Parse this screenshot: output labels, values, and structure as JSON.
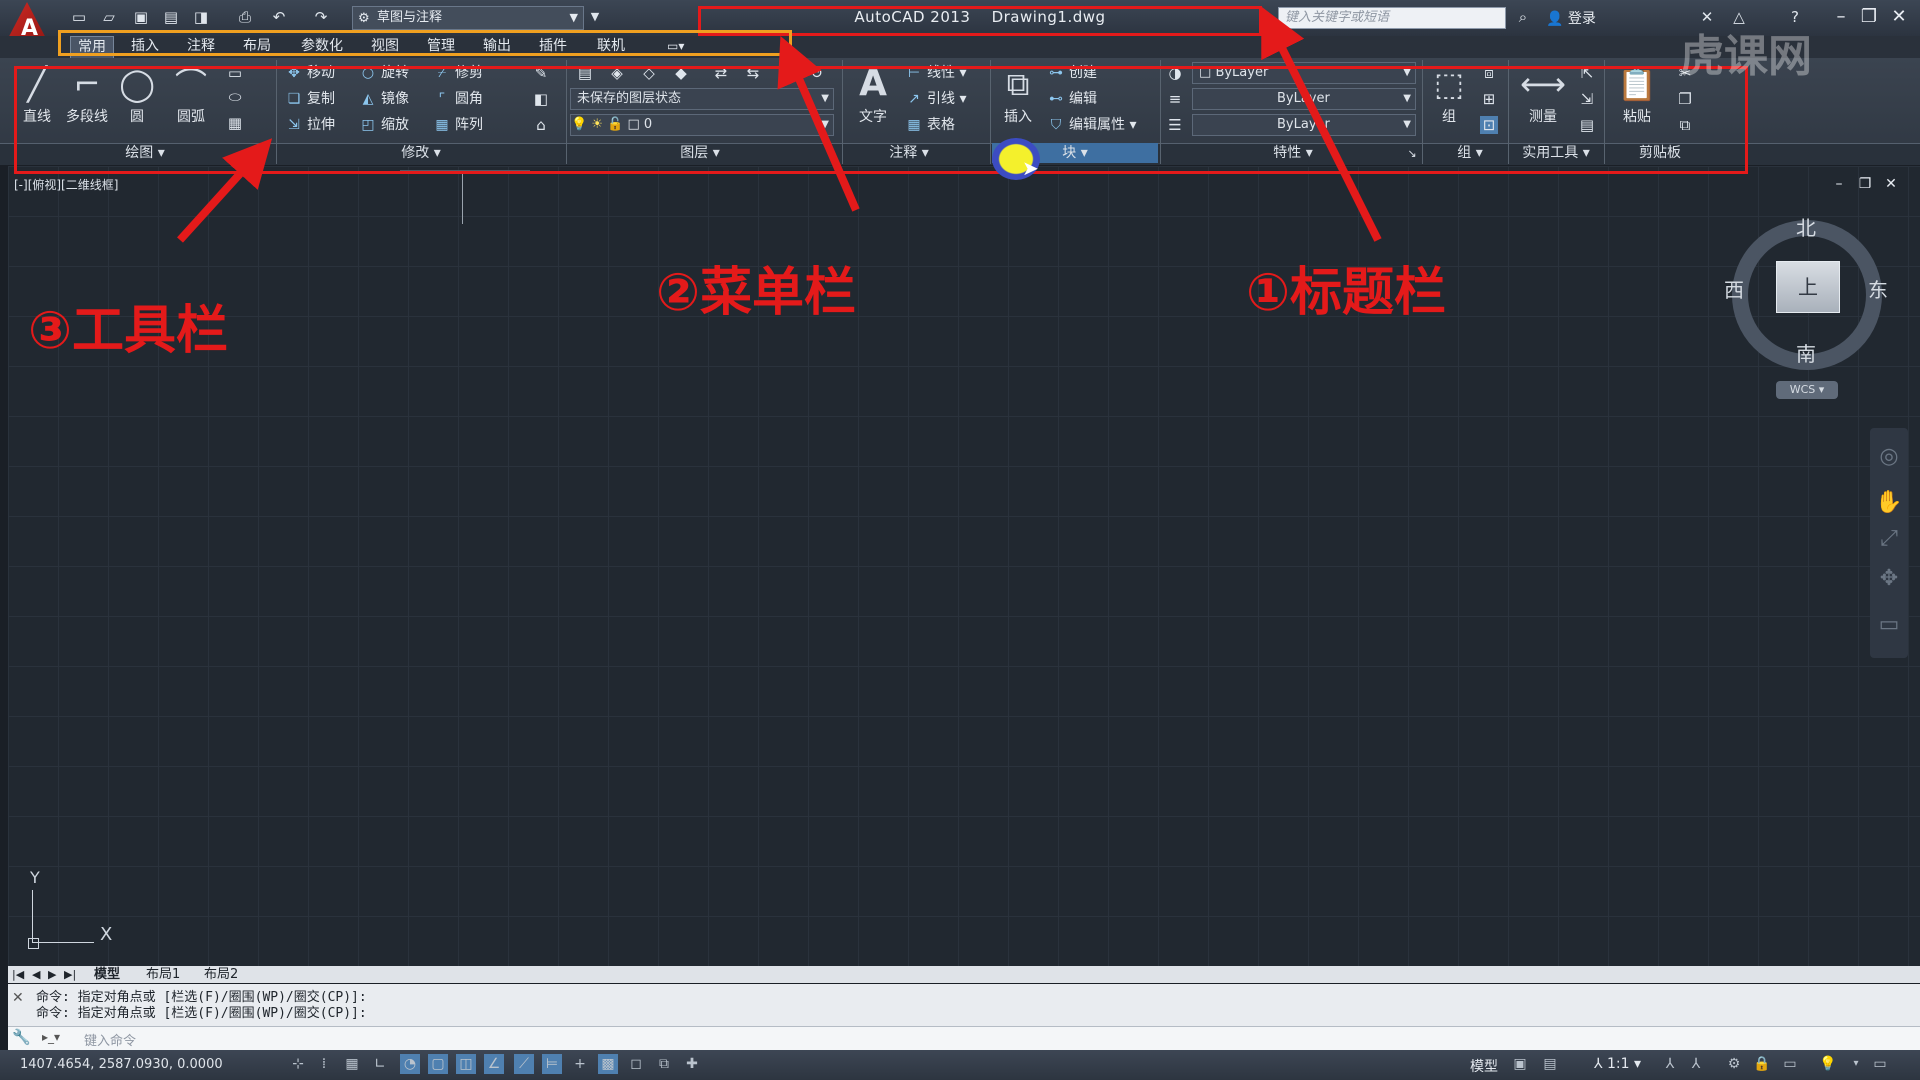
{
  "title_bar": {
    "app_name": "AutoCAD 2013",
    "document": "Drawing1.dwg",
    "workspace": "草图与注释",
    "search_placeholder": "键入关键字或短语",
    "login": "登录",
    "logo_letter": "A"
  },
  "ribbon_tabs": [
    "常用",
    "插入",
    "注释",
    "布局",
    "参数化",
    "视图",
    "管理",
    "输出",
    "插件",
    "联机"
  ],
  "draw_panel": {
    "title": "绘图",
    "tools": [
      "直线",
      "多段线",
      "圆",
      "圆弧"
    ]
  },
  "modify_panel": {
    "title": "修改",
    "row1": [
      "移动",
      "旋转",
      "修剪"
    ],
    "row2": [
      "复制",
      "镜像",
      "圆角"
    ],
    "row3": [
      "拉伸",
      "缩放",
      "阵列"
    ]
  },
  "layers_panel": {
    "title": "图层",
    "layer_state": "未保存的图层状态",
    "current_layer": "0"
  },
  "annotation_panel": {
    "title": "注释",
    "text_tool": "文字",
    "tools": [
      "线性",
      "引线",
      "表格"
    ]
  },
  "block_panel": {
    "title": "块",
    "insert": "插入",
    "tools": [
      "创建",
      "编辑",
      "编辑属性"
    ]
  },
  "properties_panel": {
    "title": "特性",
    "color": "ByLayer",
    "linetype": "ByLayer",
    "lineweight": "ByLayer"
  },
  "groups_panel": {
    "title": "组",
    "tool": "组"
  },
  "utilities_panel": {
    "title": "实用工具",
    "tool": "测量"
  },
  "clipboard_panel": {
    "title": "剪贴板",
    "tool": "粘贴"
  },
  "viewport": {
    "label": "[-][俯视][二维线框]",
    "compass": {
      "north": "北",
      "south": "南",
      "east": "东",
      "west": "西"
    },
    "cube_face": "上",
    "wcs": "WCS",
    "ucs_x": "X",
    "ucs_y": "Y"
  },
  "layout_tabs": [
    "模型",
    "布局1",
    "布局2"
  ],
  "command_lines": [
    "命令: 指定对角点或 [栏选(F)/圈围(WP)/圈交(CP)]:",
    "命令: 指定对角点或 [栏选(F)/圈围(WP)/圈交(CP)]:"
  ],
  "command_placeholder": "键入命令",
  "status": {
    "coordinates": "1407.4654, 2587.0930, 0.0000",
    "model": "模型",
    "scale": "1:1"
  },
  "annotations": {
    "title_bar_label": "①标题栏",
    "menu_bar_label": "②菜单栏",
    "toolbar_label": "③工具栏",
    "color": "#e41a1a"
  },
  "watermark": "虎课网",
  "colors": {
    "ribbon_bg": "#3b4450",
    "drawing_bg": "#212830",
    "accent_highlight": "#3e6fa1",
    "menu_box": "#f0a020"
  }
}
